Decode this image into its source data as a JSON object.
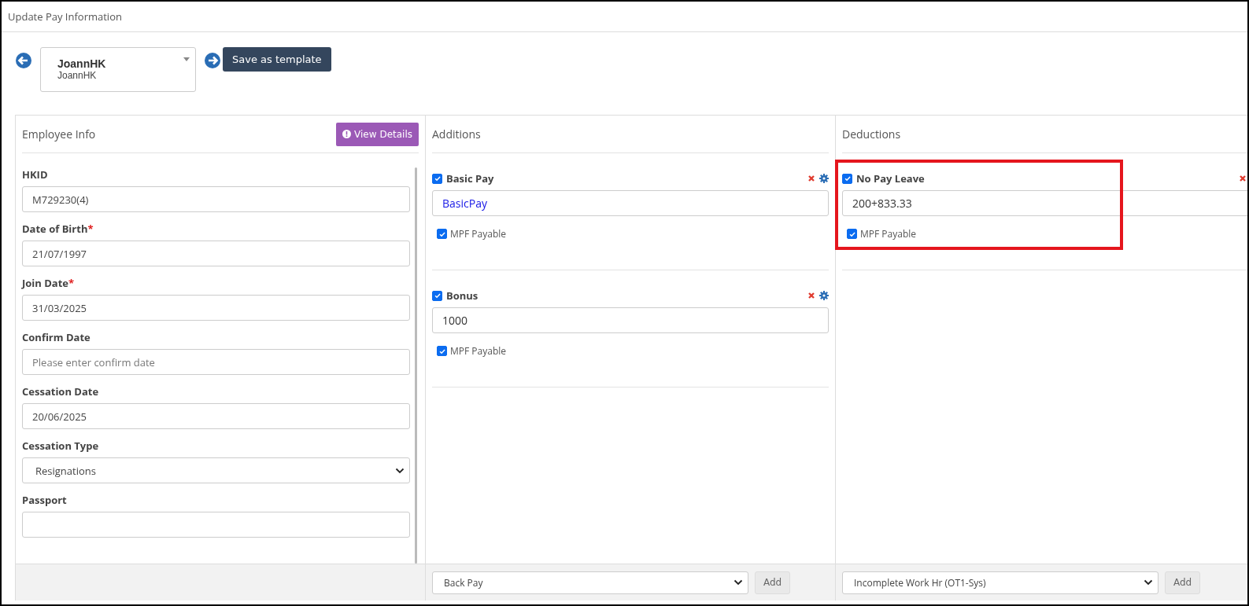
{
  "page_title": "Update Pay Information",
  "employee_picker": {
    "name": "JoannHK",
    "sub_name": "JoannHK"
  },
  "save_template_button": "Save as template",
  "employee_info": {
    "title": "Employee Info",
    "view_details_button": "View Details",
    "fields": [
      {
        "label": "HKID",
        "kind": "text",
        "value": "M729230(4)"
      },
      {
        "label": "Date of Birth",
        "required_mark": "*",
        "kind": "text",
        "value": "21/07/1997"
      },
      {
        "label": "Join Date",
        "required_mark": "*",
        "kind": "text",
        "value": "31/03/2025"
      },
      {
        "label": "Confirm Date",
        "kind": "text",
        "placeholder": "Please enter confirm date"
      },
      {
        "label": "Cessation Date",
        "kind": "text",
        "value": "20/06/2025"
      },
      {
        "label": "Cessation Type",
        "kind": "select",
        "value": "Resignations"
      },
      {
        "label": "Passport",
        "kind": "text"
      }
    ]
  },
  "additions": {
    "title": "Additions",
    "items": [
      {
        "name": "Basic Pay",
        "checked": true,
        "kind": "formula",
        "value": "BasicPay",
        "mpf_label": "MPF Payable",
        "mpf_payable": true
      },
      {
        "name": "Bonus",
        "checked": true,
        "kind": "number",
        "value": "1000",
        "mpf_label": "MPF Payable",
        "mpf_payable": true
      }
    ],
    "add_select": "Back Pay",
    "add_button": "Add"
  },
  "deductions": {
    "title": "Deductions",
    "items": [
      {
        "name": "No Pay Leave",
        "checked": true,
        "kind": "number",
        "value": "200+833.33",
        "mpf_label": "MPF Payable",
        "mpf_payable": true,
        "highlighted": true
      }
    ],
    "add_select": "Incomplete Work Hr (OT1-Sys)",
    "add_button": "Add"
  }
}
